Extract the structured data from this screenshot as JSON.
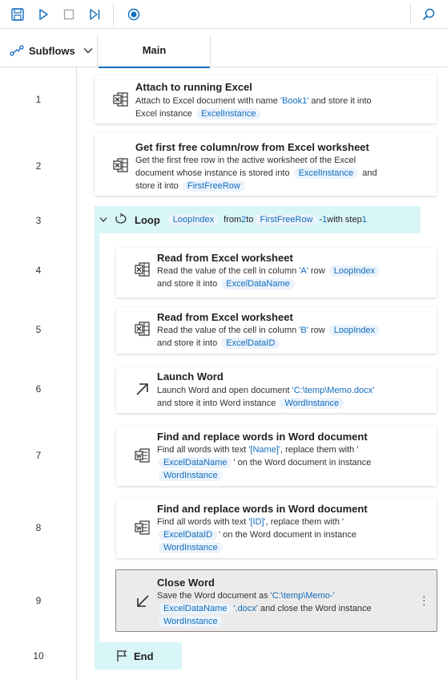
{
  "toolbar": {
    "icons": [
      "save-icon",
      "run-icon",
      "stop-icon",
      "run-next-action-icon",
      "record-icon",
      "search-icon"
    ]
  },
  "tabs": {
    "subflows_label": "Subflows",
    "main_label": "Main"
  },
  "line_numbers": [
    "1",
    "2",
    "3",
    "4",
    "5",
    "6",
    "7",
    "8",
    "9",
    "10"
  ],
  "actions": {
    "a1": {
      "title": "Attach to running Excel",
      "d1": "Attach to Excel document with name ",
      "book": "'Book1'",
      "d2": " and store it into",
      "d3": "Excel instance ",
      "var": "ExcelInstance"
    },
    "a2": {
      "title": "Get first free column/row from Excel worksheet",
      "d1": "Get the first free row in the active worksheet of the Excel",
      "d2": "document whose instance is stored into ",
      "var1": "ExcelInstance",
      "d3": " and",
      "d4": "store it into ",
      "var2": "FirstFreeRow"
    },
    "loop": {
      "kw": "Loop",
      "var": "LoopIndex",
      "from": "from ",
      "start": "2",
      "to": " to ",
      "endvar": "FirstFreeRow",
      "minus": " - ",
      "one": "1",
      "step": " with step ",
      "stepval": "1"
    },
    "a4": {
      "title": "Read from Excel worksheet",
      "d1": "Read the value of the cell in column ",
      "col": "'A'",
      "d2": " row ",
      "var1": "LoopIndex",
      "d3": "and store it into ",
      "var2": "ExcelDataName"
    },
    "a5": {
      "title": "Read from Excel worksheet",
      "d1": "Read the value of the cell in column ",
      "col": "'B'",
      "d2": " row ",
      "var1": "LoopIndex",
      "d3": "and store it into ",
      "var2": "ExcelDataID"
    },
    "a6": {
      "title": "Launch Word",
      "d1": "Launch Word and open document ",
      "path": "'C:\\temp\\Memo.docx'",
      "d2": "and store it into Word instance ",
      "var": "WordInstance"
    },
    "a7": {
      "title": "Find and replace words in Word document",
      "d1": "Find all words with text ",
      "text": "'[Name]'",
      "d2": ", replace them with  '",
      "var1": "ExcelDataName",
      "d3": "' on the Word document in instance",
      "var2": "WordInstance"
    },
    "a8": {
      "title": "Find and replace words in Word document",
      "d1": "Find all words with text ",
      "text": "'[ID]'",
      "d2": ", replace them with  '",
      "var1": "ExcelDataID",
      "d3": "' on the Word document in instance",
      "var2": "WordInstance"
    },
    "a9": {
      "title": "Close Word",
      "d1": "Save the Word document as ",
      "path": "'C:\\temp\\Memo-'",
      "var1": "ExcelDataName",
      "ext": "'.docx'",
      "d2": " and close the Word instance",
      "var2": "WordInstance"
    },
    "end": {
      "kw": "End"
    }
  },
  "colors": {
    "accent": "#0f6cbd",
    "loop_bg": "#d8f5f7",
    "pill_bg": "#ebf3fc",
    "selected_bg": "#edebe9"
  }
}
